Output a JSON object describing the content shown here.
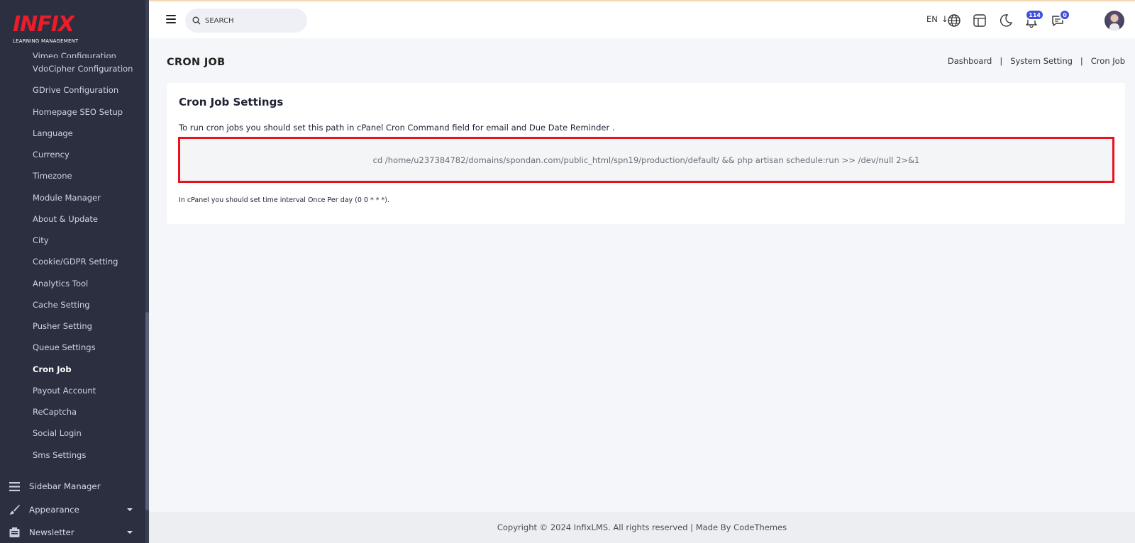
{
  "brand": {
    "logo_text": "INFIX",
    "logo_subtitle": "LEARNING MANAGEMENT",
    "accent_color": "#ec1c2a"
  },
  "sidebar": {
    "sub_items": [
      {
        "label": "Vimeo Configuration",
        "active": false
      },
      {
        "label": "VdoCipher Configuration",
        "active": false
      },
      {
        "label": "GDrive Configuration",
        "active": false
      },
      {
        "label": "Homepage SEO Setup",
        "active": false
      },
      {
        "label": "Language",
        "active": false
      },
      {
        "label": "Currency",
        "active": false
      },
      {
        "label": "Timezone",
        "active": false
      },
      {
        "label": "Module Manager",
        "active": false
      },
      {
        "label": "About & Update",
        "active": false
      },
      {
        "label": "City",
        "active": false
      },
      {
        "label": "Cookie/GDPR Setting",
        "active": false
      },
      {
        "label": "Analytics Tool",
        "active": false
      },
      {
        "label": "Cache Setting",
        "active": false
      },
      {
        "label": "Pusher Setting",
        "active": false
      },
      {
        "label": "Queue Settings",
        "active": false
      },
      {
        "label": "Cron Job",
        "active": true
      },
      {
        "label": "Payout Account",
        "active": false
      },
      {
        "label": "ReCaptcha",
        "active": false
      },
      {
        "label": "Social Login",
        "active": false
      },
      {
        "label": "Sms Settings",
        "active": false
      }
    ],
    "main_items": [
      {
        "label": "Sidebar Manager",
        "icon": "list-icon",
        "has_caret": false
      },
      {
        "label": "Appearance",
        "icon": "brush-icon",
        "has_caret": true
      },
      {
        "label": "Newsletter",
        "icon": "newsletter-icon",
        "has_caret": true
      }
    ]
  },
  "topbar": {
    "search_placeholder": "SEARCH",
    "language": "EN",
    "notification_count": "114",
    "message_count": "0"
  },
  "page": {
    "title": "CRON JOB",
    "breadcrumb": [
      "Dashboard",
      "System Setting",
      "Cron Job"
    ]
  },
  "card": {
    "title": "Cron Job Settings",
    "description": "To run cron jobs you should set this path in cPanel Cron Command field for email and Due Date Reminder .",
    "command": "cd /home/u237384782/domains/spondan.com/public_html/spn19/production/default/ && php artisan schedule:run >> /dev/null 2>&1",
    "note": "In cPanel you should set time interval Once Per day (0 0 * * *)."
  },
  "footer": {
    "text": "Copyright © 2024 InfixLMS. All rights reserved | Made By CodeThemes"
  }
}
